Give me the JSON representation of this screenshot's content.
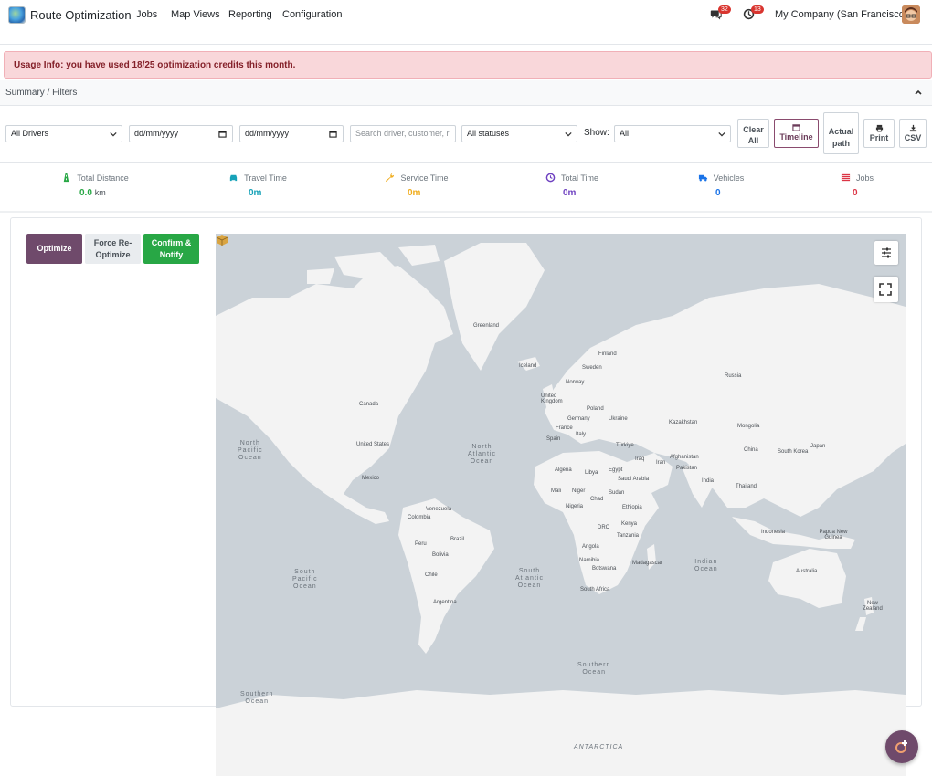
{
  "navbar": {
    "app_name": "Route Optimization",
    "menu": [
      "Jobs",
      "Map Views",
      "Reporting",
      "Configuration"
    ],
    "messages_badge": "32",
    "activity_badge": "13",
    "company": "My Company (San Francisco)"
  },
  "alert": {
    "text": "Usage Info: you have used 18/25 optimization credits this month."
  },
  "summary": {
    "title": "Summary / Filters"
  },
  "filters": {
    "driver": "All Drivers",
    "date_from_placeholder": "dd/mm/yyyy",
    "date_to_placeholder": "dd/mm/yyyy",
    "search_placeholder": "Search driver, customer, r",
    "status": "All statuses",
    "show_label": "Show:",
    "show_value": "All",
    "clear_all": [
      "Clear",
      "All"
    ],
    "timeline": "Timeline",
    "actual_path": [
      "Actual",
      "path"
    ],
    "print": "Print",
    "csv": "CSV"
  },
  "stats": [
    {
      "label": "Total Distance",
      "value": "0.0",
      "unit": "km",
      "color": "#28a745",
      "icon": "road-icon"
    },
    {
      "label": "Travel Time",
      "value": "0m",
      "unit": "",
      "color": "#17a2b8",
      "icon": "car-icon"
    },
    {
      "label": "Service Time",
      "value": "0m",
      "unit": "",
      "color": "#f0ad1f",
      "icon": "wrench-icon"
    },
    {
      "label": "Total Time",
      "value": "0m",
      "unit": "",
      "color": "#6f42c1",
      "icon": "clock-icon"
    },
    {
      "label": "Vehicles",
      "value": "0",
      "unit": "",
      "color": "#1a73e8",
      "icon": "truck-icon"
    },
    {
      "label": "Jobs",
      "value": "0",
      "unit": "",
      "color": "#dc3545",
      "icon": "flag-icon"
    }
  ],
  "actions": {
    "optimize": "Optimize",
    "force": [
      "Force Re-",
      "Optimize"
    ],
    "confirm": [
      "Confirm &",
      "Notify"
    ]
  },
  "map": {
    "countries": [
      "Greenland",
      "Iceland",
      "Finland",
      "Sweden",
      "Norway",
      "Russia",
      "Canada",
      "United Kingdom",
      "Poland",
      "Germany",
      "Ukraine",
      "France",
      "Kazakhstan",
      "Mongolia",
      "Spain",
      "Italy",
      "Türkiye",
      "United States",
      "China",
      "South Korea",
      "Japan",
      "Iraq",
      "Iran",
      "Afghanistan",
      "Pakistan",
      "Algeria",
      "Libya",
      "Egypt",
      "Saudi Arabia",
      "India",
      "Mexico",
      "Mali",
      "Niger",
      "Sudan",
      "Thailand",
      "Chad",
      "Nigeria",
      "Ethiopia",
      "Venezuela",
      "Colombia",
      "DRC",
      "Kenya",
      "Tanzania",
      "Indonesia",
      "Papua New Guinea",
      "Brazil",
      "Peru",
      "Angola",
      "Bolivia",
      "Namibia",
      "Madagascar",
      "Botswana",
      "Australia",
      "Chile",
      "South Africa",
      "Argentina",
      "New Zealand"
    ],
    "oceans": {
      "north_pacific": "North\nPacific\nOcean",
      "north_atlantic": "North\nAtlantic\nOcean",
      "south_pacific": "South\nPacific\nOcean",
      "south_atlantic": "South\nAtlantic\nOcean",
      "indian": "Indian\nOcean",
      "southern_1": "Southern\nOcean",
      "southern_2": "Southern\nOcean",
      "antarctica": "ANTARCTICA"
    }
  }
}
